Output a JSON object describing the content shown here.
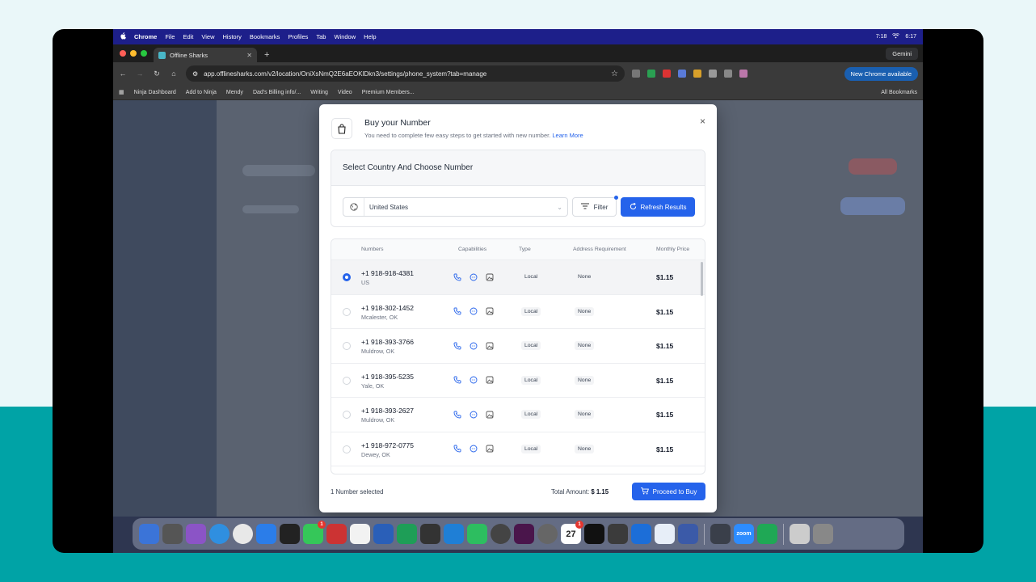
{
  "menubar": {
    "apple": "",
    "items": [
      "Chrome",
      "File",
      "Edit",
      "View",
      "History",
      "Bookmarks",
      "Profiles",
      "Tab",
      "Window",
      "Help"
    ],
    "time": "6:17",
    "timer": "7:18"
  },
  "browser": {
    "tab_title": "Offline Sharks",
    "gemini": "Gemini",
    "url": "app.offlinesharks.com/v2/location/OniXsNmQ2E6aEOKlDkn3/settings/phone_system?tab=manage",
    "new_chrome": "New Chrome available",
    "bookmarks": [
      "Ninja Dashboard",
      "Add to Ninja",
      "Mendy",
      "Dad's Billing info/...",
      "Writing",
      "Video",
      "Premium Members..."
    ],
    "all_bookmarks": "All Bookmarks"
  },
  "modal": {
    "title": "Buy your Number",
    "subtitle": "You need to complete few easy steps to get started with new number.",
    "learn_more": "Learn More",
    "close": "×",
    "section_title": "Select Country And Choose Number",
    "country": "United States",
    "filter_label": "Filter",
    "refresh_label": "Refresh Results",
    "columns": {
      "numbers": "Numbers",
      "capabilities": "Capabilities",
      "type": "Type",
      "address": "Address Requirement",
      "price": "Monthly Price"
    },
    "rows": [
      {
        "number": "+1 918-918-4381",
        "location": "US",
        "type": "Local",
        "address": "None",
        "price": "$1.15",
        "selected": true
      },
      {
        "number": "+1 918-302-1452",
        "location": "Mcalester, OK",
        "type": "Local",
        "address": "None",
        "price": "$1.15",
        "selected": false
      },
      {
        "number": "+1 918-393-3766",
        "location": "Muldrow, OK",
        "type": "Local",
        "address": "None",
        "price": "$1.15",
        "selected": false
      },
      {
        "number": "+1 918-395-5235",
        "location": "Yale, OK",
        "type": "Local",
        "address": "None",
        "price": "$1.15",
        "selected": false
      },
      {
        "number": "+1 918-393-2627",
        "location": "Muldrow, OK",
        "type": "Local",
        "address": "None",
        "price": "$1.15",
        "selected": false
      },
      {
        "number": "+1 918-972-0775",
        "location": "Dewey, OK",
        "type": "Local",
        "address": "None",
        "price": "$1.15",
        "selected": false
      }
    ],
    "selected_count": "1 Number selected",
    "total_label": "Total Amount:",
    "total_value": "$ 1.15",
    "proceed_label": "Proceed to Buy"
  },
  "dock": {
    "calendar_day": "27",
    "zoom_label": "zoom",
    "badges": {
      "messages": "1",
      "calendar": "1"
    }
  }
}
